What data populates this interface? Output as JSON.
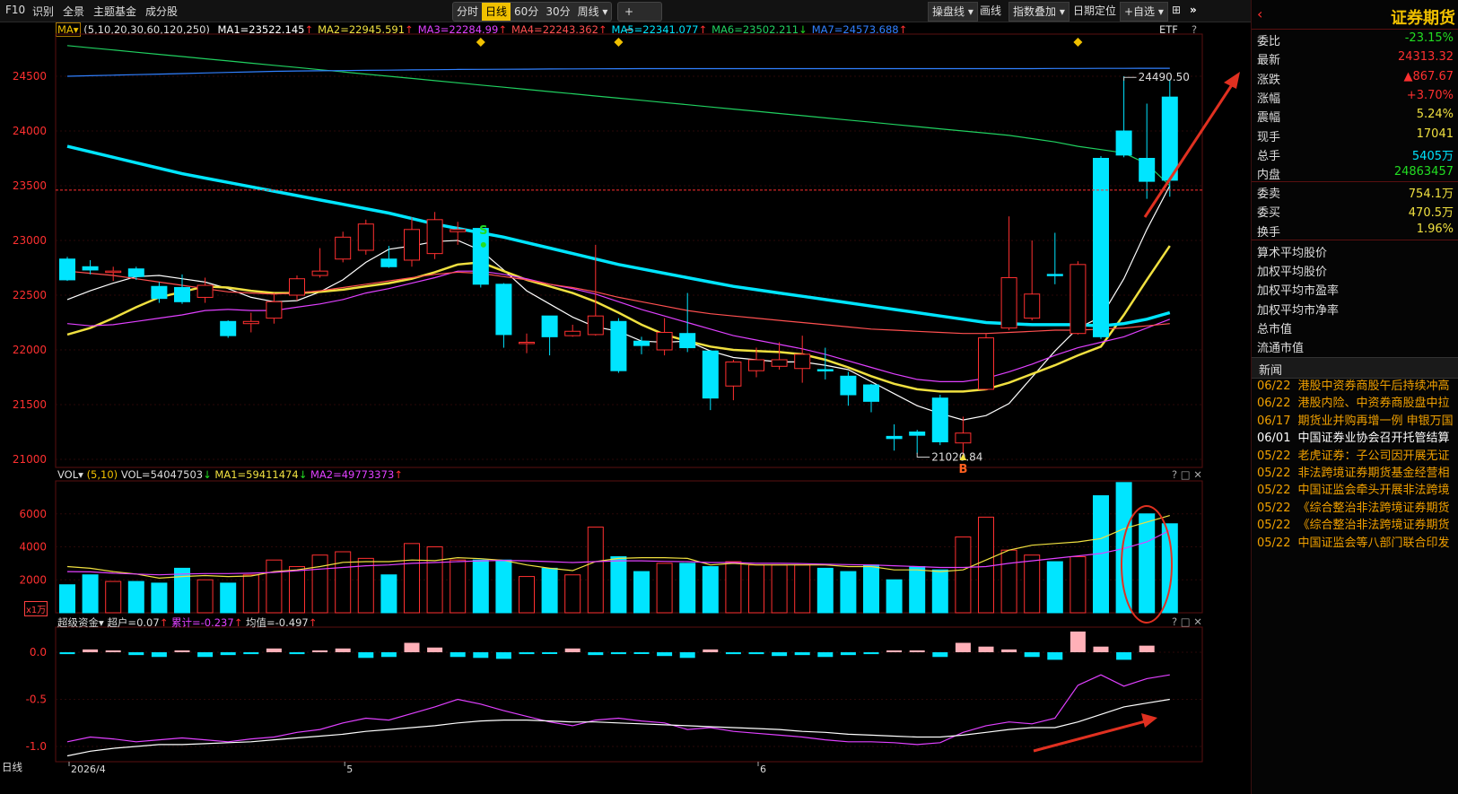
{
  "topbar": {
    "left_items": [
      "F10",
      "识别",
      "全景",
      "主题基金",
      "成分股"
    ],
    "periods": [
      "分时",
      "日线",
      "60分",
      "30分",
      "周线 ▾"
    ],
    "active_period": "日线",
    "zoom_in": "+",
    "zoom_out": "−",
    "right_items": [
      "操盘线 ▾",
      "画线",
      "指数叠加 ▾",
      "日期定位",
      "+自选 ▾"
    ]
  },
  "ma_legend": {
    "label": "MA▾",
    "params": "(5,10,20,30,60,120,250)",
    "items": [
      {
        "text": "MA1=23522.145",
        "color": "#ffffff",
        "arrow": "↑"
      },
      {
        "text": "MA2=22945.591",
        "color": "#f0e040",
        "arrow": "↑"
      },
      {
        "text": "MA3=22284.99",
        "color": "#e040ff",
        "arrow": "↑"
      },
      {
        "text": "MA4=22243.362",
        "color": "#ff5050",
        "arrow": "↑"
      },
      {
        "text": "MA5=22341.077",
        "color": "#00e5ff",
        "arrow": "↑"
      },
      {
        "text": "MA6=23502.211",
        "color": "#20d060",
        "arrow": "↓"
      },
      {
        "text": "MA7=24573.688",
        "color": "#3080ff",
        "arrow": "↑"
      }
    ],
    "etf": "ETF",
    "help": "?"
  },
  "price_axis": [
    "24500",
    "24000",
    "23500",
    "23000",
    "22500",
    "22000",
    "21500",
    "21000"
  ],
  "price_annotations": {
    "high": "24490.50",
    "low": "21020.84",
    "buy_mark": "B",
    "sell_mark": "S"
  },
  "vol_legend": {
    "label": "VOL▾",
    "params": "(5,10)",
    "vol": "VOL=54047503",
    "vol_arrow": "↓",
    "ma1": "MA1=59411474",
    "ma1_arrow": "↓",
    "ma2": "MA2=49773373",
    "ma2_arrow": "↑",
    "unit": "x1万"
  },
  "vol_axis": [
    "6000",
    "4000",
    "2000"
  ],
  "fund_legend": {
    "label": "超级资金▾",
    "chaohu": "超户=0.07",
    "leiji": "累计=-0.237",
    "junzhi": "均值=-0.497",
    "arrow_up": "↑"
  },
  "fund_axis": [
    "0.0",
    "-0.5",
    "-1.0"
  ],
  "date_axis": {
    "label": "日线",
    "ticks": [
      "2026/4",
      "5",
      "6"
    ]
  },
  "side": {
    "title": "证券期货",
    "quote_rows": [
      {
        "k": "委比",
        "v": "-23.15%",
        "c": "#22dd22"
      },
      {
        "k": "最新",
        "v": "24313.32",
        "c": "#ff3030"
      },
      {
        "k": "涨跌",
        "v": "▲867.67",
        "c": "#ff3030"
      },
      {
        "k": "涨幅",
        "v": "+3.70%",
        "c": "#ff3030"
      },
      {
        "k": "震幅",
        "v": "5.24%",
        "c": "#f0e040"
      },
      {
        "k": "现手",
        "v": "17041",
        "c": "#f0e040"
      },
      {
        "k": "总手",
        "v": "5405万",
        "c": "#00e5ff"
      },
      {
        "k": "内盘",
        "v": "24863457",
        "c": "#22dd22"
      }
    ],
    "quote_rows2": [
      {
        "k": "委卖",
        "v": "754.1万",
        "c": "#f0e040"
      },
      {
        "k": "委买",
        "v": "470.5万",
        "c": "#f0e040"
      },
      {
        "k": "换手",
        "v": "1.96%",
        "c": "#f0e040"
      }
    ],
    "links": [
      "算术平均股价",
      "加权平均股价",
      "加权平均市盈率",
      "加权平均市净率",
      "总市值",
      "流通市值"
    ],
    "news_title": "新闻",
    "news": [
      {
        "d": "06/22",
        "t": "港股中资券商股午后持续冲高",
        "c": "#f0a000"
      },
      {
        "d": "06/22",
        "t": "港股内险、中资券商股盘中拉",
        "c": "#f0a000"
      },
      {
        "d": "06/17",
        "t": "期货业并购再增一例 申银万国",
        "c": "#f0a000"
      },
      {
        "d": "06/01",
        "t": "中国证券业协会召开托管结算",
        "c": "#ffffff"
      },
      {
        "d": "05/22",
        "t": "老虎证券：子公司因开展无证",
        "c": "#f0a000"
      },
      {
        "d": "05/22",
        "t": "非法跨境证券期货基金经营相",
        "c": "#f0a000"
      },
      {
        "d": "05/22",
        "t": "中国证监会牵头开展非法跨境",
        "c": "#f0a000"
      },
      {
        "d": "05/22",
        "t": "《综合整治非法跨境证券期货",
        "c": "#f0a000"
      },
      {
        "d": "05/22",
        "t": "《综合整治非法跨境证券期货",
        "c": "#f0a000"
      },
      {
        "d": "05/22",
        "t": "中国证监会等八部门联合印发",
        "c": "#f0a000"
      }
    ]
  },
  "chart_data": {
    "type": "candlestick",
    "price_ylim": [
      21000,
      24600
    ],
    "candles": [
      [
        22830,
        22640,
        22850,
        22630
      ],
      [
        22760,
        22730,
        22820,
        22690
      ],
      [
        22710,
        22720,
        22760,
        22630
      ],
      [
        22740,
        22670,
        22760,
        22640
      ],
      [
        22580,
        22470,
        22620,
        22430
      ],
      [
        22570,
        22440,
        22690,
        22420
      ],
      [
        22480,
        22590,
        22660,
        22430
      ],
      [
        22260,
        22130,
        22270,
        22110
      ],
      [
        22240,
        22260,
        22340,
        22160
      ],
      [
        22290,
        22440,
        22520,
        22240
      ],
      [
        22500,
        22650,
        22680,
        22450
      ],
      [
        22680,
        22720,
        22930,
        22660
      ],
      [
        22830,
        23030,
        23080,
        22800
      ],
      [
        22910,
        23150,
        23190,
        22870
      ],
      [
        22830,
        22760,
        22950,
        22750
      ],
      [
        22820,
        23100,
        23210,
        22760
      ],
      [
        22880,
        23190,
        23260,
        22830
      ],
      [
        23080,
        23100,
        23170,
        22960
      ],
      [
        23110,
        22600,
        23120,
        22570
      ],
      [
        22600,
        22140,
        22610,
        22020
      ],
      [
        22070,
        22070,
        22150,
        21970
      ],
      [
        22310,
        22120,
        22310,
        21950
      ],
      [
        22130,
        22170,
        22230,
        22120
      ],
      [
        22140,
        22310,
        22960,
        22130
      ],
      [
        22260,
        21810,
        22290,
        21790
      ],
      [
        22080,
        22040,
        22120,
        21960
      ],
      [
        22000,
        22160,
        22290,
        21950
      ],
      [
        22150,
        22020,
        22520,
        21980
      ],
      [
        21990,
        21560,
        22000,
        21450
      ],
      [
        21670,
        21890,
        21910,
        21540
      ],
      [
        21810,
        21910,
        22020,
        21750
      ],
      [
        21850,
        21910,
        22070,
        21820
      ],
      [
        21830,
        21960,
        22130,
        21700
      ],
      [
        21820,
        21810,
        22020,
        21730
      ],
      [
        21760,
        21590,
        21800,
        21490
      ],
      [
        21680,
        21530,
        21690,
        21430
      ],
      [
        21210,
        21190,
        21320,
        21080
      ],
      [
        21250,
        21220,
        21270,
        21050
      ],
      [
        21560,
        21160,
        21590,
        21130
      ],
      [
        21150,
        21240,
        21390,
        21030
      ],
      [
        21640,
        22110,
        22150,
        21630
      ],
      [
        22200,
        22660,
        23220,
        22180
      ],
      [
        22290,
        22510,
        23000,
        22270
      ],
      [
        22690,
        22680,
        23070,
        22600
      ],
      [
        22150,
        22780,
        22810,
        22140
      ],
      [
        23750,
        22120,
        23770,
        22100
      ],
      [
        24000,
        23780,
        24500,
        23760
      ],
      [
        23750,
        23540,
        24250,
        23380
      ],
      [
        24310,
        23550,
        24470,
        23400
      ]
    ],
    "ma_series": [
      {
        "name": "MA1",
        "color": "#ffffff",
        "values": [
          22460,
          22540,
          22610,
          22670,
          22680,
          22650,
          22620,
          22560,
          22480,
          22440,
          22450,
          22530,
          22640,
          22800,
          22920,
          22950,
          22990,
          23000,
          22910,
          22730,
          22540,
          22420,
          22300,
          22210,
          22170,
          22080,
          22070,
          22080,
          21990,
          21930,
          21910,
          21890,
          21890,
          21860,
          21820,
          21710,
          21600,
          21490,
          21420,
          21360,
          21400,
          21510,
          21750,
          21990,
          22200,
          22300,
          22650,
          23100,
          23500
        ]
      },
      {
        "name": "MA2",
        "color": "#f0e040",
        "values": [
          22140,
          22200,
          22290,
          22390,
          22480,
          22530,
          22580,
          22570,
          22540,
          22520,
          22520,
          22530,
          22550,
          22580,
          22610,
          22650,
          22710,
          22780,
          22800,
          22720,
          22640,
          22580,
          22520,
          22440,
          22340,
          22230,
          22140,
          22080,
          22030,
          22000,
          21990,
          21980,
          21960,
          21910,
          21840,
          21760,
          21690,
          21640,
          21620,
          21620,
          21640,
          21700,
          21780,
          21860,
          21950,
          22030,
          22320,
          22640,
          22950
        ]
      },
      {
        "name": "MA3",
        "color": "#e040ff",
        "values": [
          22240,
          22220,
          22230,
          22260,
          22290,
          22320,
          22360,
          22370,
          22360,
          22360,
          22390,
          22420,
          22460,
          22520,
          22560,
          22610,
          22660,
          22720,
          22720,
          22690,
          22650,
          22600,
          22560,
          22510,
          22440,
          22370,
          22310,
          22250,
          22190,
          22130,
          22090,
          22050,
          22010,
          21960,
          21900,
          21840,
          21780,
          21730,
          21710,
          21710,
          21740,
          21800,
          21870,
          21950,
          22020,
          22070,
          22120,
          22200,
          22280
        ]
      },
      {
        "name": "MA4",
        "color": "#ff5050",
        "values": [
          22720,
          22700,
          22680,
          22650,
          22620,
          22590,
          22560,
          22530,
          22520,
          22510,
          22520,
          22540,
          22570,
          22600,
          22630,
          22660,
          22690,
          22710,
          22700,
          22670,
          22640,
          22600,
          22570,
          22530,
          22480,
          22440,
          22400,
          22360,
          22330,
          22310,
          22290,
          22270,
          22250,
          22230,
          22210,
          22190,
          22180,
          22170,
          22160,
          22150,
          22150,
          22160,
          22170,
          22180,
          22180,
          22190,
          22200,
          22220,
          22240
        ]
      },
      {
        "name": "MA5",
        "color": "#00e5ff",
        "values": [
          23860,
          23810,
          23760,
          23710,
          23660,
          23610,
          23570,
          23530,
          23490,
          23450,
          23410,
          23370,
          23330,
          23290,
          23250,
          23200,
          23150,
          23110,
          23070,
          23030,
          22980,
          22930,
          22880,
          22830,
          22780,
          22740,
          22700,
          22660,
          22620,
          22580,
          22550,
          22520,
          22490,
          22460,
          22430,
          22400,
          22370,
          22340,
          22310,
          22280,
          22250,
          22240,
          22230,
          22230,
          22230,
          22220,
          22240,
          22280,
          22340
        ]
      },
      {
        "name": "MA6",
        "color": "#20d060",
        "values": [
          24780,
          24760,
          24740,
          24720,
          24700,
          24680,
          24660,
          24640,
          24620,
          24600,
          24580,
          24560,
          24540,
          24520,
          24500,
          24480,
          24460,
          24440,
          24420,
          24400,
          24380,
          24360,
          24340,
          24320,
          24300,
          24280,
          24260,
          24240,
          24220,
          24200,
          24180,
          24160,
          24140,
          24120,
          24100,
          24080,
          24060,
          24040,
          24020,
          24000,
          23980,
          23960,
          23930,
          23900,
          23860,
          23830,
          23800,
          23700,
          23500
        ]
      },
      {
        "name": "MA7",
        "color": "#3080ff",
        "values": [
          24500,
          24505,
          24510,
          24515,
          24520,
          24525,
          24530,
          24535,
          24540,
          24545,
          24548,
          24550,
          24552,
          24554,
          24556,
          24558,
          24560,
          24562,
          24563,
          24564,
          24565,
          24566,
          24567,
          24568,
          24569,
          24570,
          24570,
          24570,
          24570,
          24570,
          24570,
          24570,
          24570,
          24570,
          24570,
          24570,
          24570,
          24570,
          24570,
          24570,
          24570,
          24570,
          24570,
          24571,
          24571,
          24572,
          24572,
          24573,
          24573
        ]
      }
    ],
    "volume_ylim": [
      0,
      8000
    ],
    "volumes": [
      1700,
      2300,
      1900,
      1900,
      1800,
      2700,
      2000,
      1800,
      2300,
      3200,
      2800,
      3500,
      3700,
      3300,
      2300,
      4200,
      4000,
      3200,
      3200,
      3200,
      2200,
      2700,
      2300,
      5200,
      3400,
      2500,
      3000,
      3000,
      2800,
      3100,
      2900,
      2900,
      2900,
      2700,
      2500,
      2900,
      2000,
      2800,
      2600,
      4600,
      5800,
      3800,
      3500,
      3100,
      3400,
      7100,
      7900,
      6000,
      5400
    ],
    "vol_ma_series": [
      {
        "name": "MA1",
        "color": "#f0e040",
        "values": [
          2800,
          2700,
          2500,
          2350,
          2100,
          2200,
          2260,
          2200,
          2230,
          2500,
          2600,
          2800,
          3060,
          3100,
          3100,
          3200,
          3160,
          3340,
          3280,
          3180,
          2900,
          2700,
          2560,
          3100,
          3300,
          3340,
          3340,
          3300,
          2900,
          3000,
          2900,
          2900,
          2900,
          2900,
          2800,
          2800,
          2600,
          2600,
          2500,
          2600,
          3200,
          3800,
          4100,
          4200,
          4300,
          4500,
          5100,
          5500,
          5900
        ]
      },
      {
        "name": "MA2",
        "color": "#e040ff",
        "values": [
          2500,
          2480,
          2400,
          2350,
          2300,
          2350,
          2380,
          2380,
          2400,
          2450,
          2550,
          2650,
          2750,
          2850,
          2900,
          3000,
          3050,
          3100,
          3150,
          3180,
          3150,
          3100,
          3050,
          3100,
          3150,
          3150,
          3120,
          3100,
          3050,
          3050,
          3000,
          3000,
          2980,
          2950,
          2920,
          2900,
          2850,
          2800,
          2750,
          2750,
          2800,
          3000,
          3150,
          3300,
          3450,
          3600,
          3900,
          4300,
          5000
        ]
      }
    ],
    "fund_ylim": [
      -1.15,
      0.25
    ],
    "fund_bars": [
      -0.02,
      0.03,
      0.02,
      -0.03,
      -0.05,
      0.02,
      -0.05,
      -0.03,
      -0.02,
      0.04,
      -0.02,
      0.02,
      0.04,
      -0.06,
      -0.05,
      0.1,
      0.05,
      -0.05,
      -0.06,
      -0.07,
      -0.02,
      -0.01,
      0.04,
      -0.03,
      -0.02,
      -0.01,
      -0.04,
      -0.06,
      0.03,
      -0.02,
      -0.02,
      -0.04,
      -0.03,
      -0.05,
      -0.03,
      -0.02,
      0.02,
      0.02,
      -0.05,
      0.1,
      0.06,
      0.03,
      -0.05,
      -0.08,
      0.22,
      0.06,
      -0.08,
      0.07
    ],
    "fund_lines": [
      {
        "name": "累计",
        "color": "#e040ff",
        "values": [
          -0.95,
          -0.9,
          -0.92,
          -0.95,
          -0.93,
          -0.91,
          -0.93,
          -0.95,
          -0.92,
          -0.9,
          -0.85,
          -0.82,
          -0.75,
          -0.7,
          -0.72,
          -0.65,
          -0.58,
          -0.5,
          -0.55,
          -0.62,
          -0.68,
          -0.74,
          -0.78,
          -0.72,
          -0.7,
          -0.73,
          -0.75,
          -0.82,
          -0.8,
          -0.84,
          -0.86,
          -0.88,
          -0.9,
          -0.93,
          -0.95,
          -0.95,
          -0.96,
          -0.98,
          -0.96,
          -0.85,
          -0.78,
          -0.74,
          -0.76,
          -0.7,
          -0.35,
          -0.24,
          -0.36,
          -0.28,
          -0.24
        ]
      },
      {
        "name": "均值",
        "color": "#ffffff",
        "values": [
          -1.1,
          -1.05,
          -1.02,
          -1.0,
          -0.98,
          -0.98,
          -0.97,
          -0.96,
          -0.95,
          -0.93,
          -0.91,
          -0.89,
          -0.87,
          -0.84,
          -0.82,
          -0.8,
          -0.78,
          -0.75,
          -0.73,
          -0.72,
          -0.72,
          -0.73,
          -0.74,
          -0.74,
          -0.75,
          -0.76,
          -0.77,
          -0.78,
          -0.79,
          -0.8,
          -0.81,
          -0.82,
          -0.84,
          -0.85,
          -0.87,
          -0.88,
          -0.89,
          -0.9,
          -0.9,
          -0.88,
          -0.85,
          -0.82,
          -0.8,
          -0.8,
          -0.74,
          -0.66,
          -0.58,
          -0.54,
          -0.5
        ]
      }
    ]
  }
}
